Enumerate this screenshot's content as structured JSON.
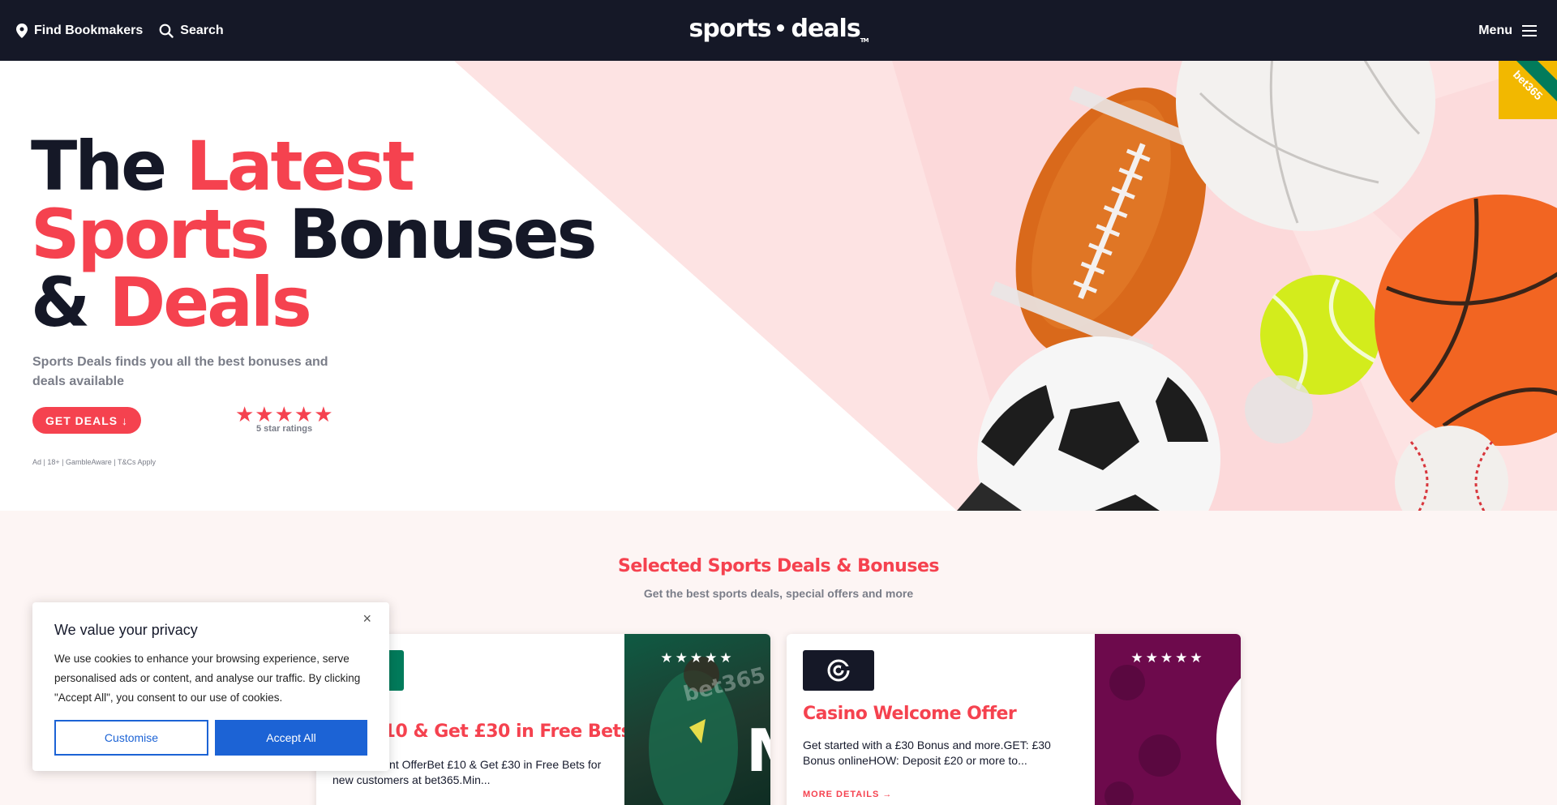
{
  "nav": {
    "find_bookmakers": "Find Bookmakers",
    "search": "Search",
    "logo_left": "sports",
    "logo_right": "deals",
    "logo_tm": "TM",
    "menu": "Menu"
  },
  "hero": {
    "title_w1": "The",
    "title_w2": "Latest",
    "title_w3": "Sports",
    "title_w4": "Bonuses",
    "title_w5": "&",
    "title_w6": "Deals",
    "subtitle": "Sports Deals finds you all the best bonuses and deals available",
    "cta": "GET DEALS ↓",
    "stars": "★★★★★",
    "stars_label": "5 star ratings",
    "disclaimer": "Ad | 18+ | GambleAware | T&Cs Apply",
    "ribbon": "bet365"
  },
  "section": {
    "title": "Selected Sports Deals & Bonuses",
    "subtitle": "Get the best sports deals, special offers and more"
  },
  "cards": [
    {
      "title": "Bet £10 & Get £30 in Free Bets",
      "text": "New Account OfferBet £10 & Get £30 in Free Bets for new customers at bet365.Min...",
      "stars": "★★★★★",
      "brand": "bet365",
      "image_letter": "M"
    },
    {
      "title": "Casino Welcome Offer",
      "text": "Get started with a £30 Bonus and more.GET: £30 Bonus onlineHOW: Deposit £20 or more to...",
      "stars": "★★★★★",
      "more": "MORE DETAILS →"
    }
  ],
  "cookie": {
    "title": "We value your privacy",
    "close": "×",
    "body": "We use cookies to enhance your browsing experience, serve personalised ads or content, and analyse our traffic. By clicking \"Accept All\", you consent to our use of cookies.",
    "customise": "Customise",
    "accept": "Accept All"
  },
  "colors": {
    "nav_bg": "#151827",
    "accent": "#f5424f",
    "pink_bg": "#fde3e3",
    "cookie_blue": "#1c63d5",
    "bet365_green": "#027b5b",
    "casino_purple": "#6d0a4c"
  }
}
